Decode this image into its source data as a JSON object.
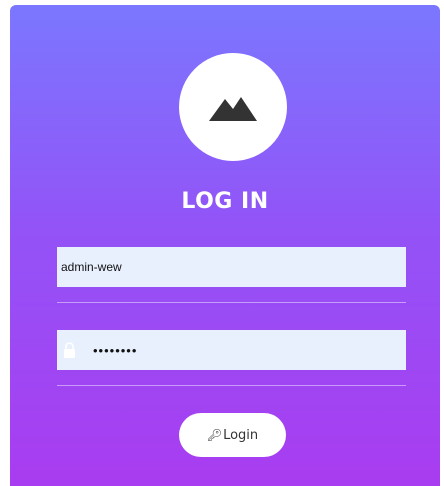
{
  "login_form": {
    "title": "LOG IN",
    "username_value": "admin-wew",
    "password_value": "••••••••",
    "login_label": "Login",
    "key_icon_glyph": "🔑︎"
  },
  "icons": {
    "logo": "mountain-icon",
    "lock": "lock-icon",
    "key": "key-icon"
  },
  "colors": {
    "gradient_top": "#7b77ff",
    "gradient_mid": "#9254f7",
    "gradient_bottom": "#a93cf0",
    "input_bg": "#e8f0fe"
  }
}
